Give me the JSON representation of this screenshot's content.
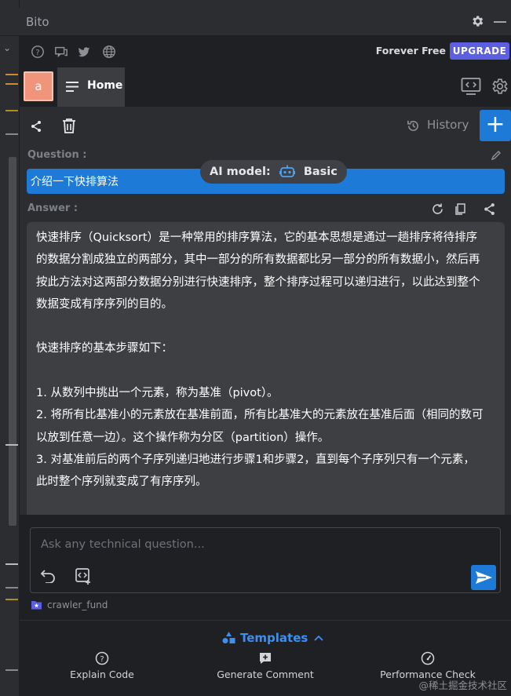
{
  "window": {
    "title": "Bito"
  },
  "topbar": {
    "icons": [
      "help-icon",
      "chat-icon",
      "twitter-icon",
      "globe-icon"
    ],
    "plan": "Forever Free",
    "upgrade_label": "UPGRADE"
  },
  "tabs": {
    "avatar_initial": "a",
    "home_label": "Home"
  },
  "toolbar": {
    "history_label": "History",
    "new_chat_symbol": "+"
  },
  "chat": {
    "question_label": "Question :",
    "question_text": "介绍一下快排算法",
    "model_label": "AI model:",
    "model_value": "Basic",
    "answer_label": "Answer :",
    "answer_lines": [
      "快速排序（Quicksort）是一种常用的排序算法，它的基本思想是通过一趟排序将待排序",
      "的数据分割成独立的两部分，其中一部分的所有数据都比另一部分的所有数据小，然后再",
      "按此方法对这两部分数据分别进行快速排序，整个排序过程可以递归进行，以此达到整个",
      "数据变成有序序列的目的。",
      "",
      "快速排序的基本步骤如下：",
      "",
      "1. 从数列中挑出一个元素，称为基准（pivot）。",
      "2. 将所有比基准小的元素放在基准前面，所有比基准大的元素放在基准后面（相同的数可",
      "以放到任意一边）。这个操作称为分区（partition）操作。",
      "3. 对基准前后的两个子序列递归地进行步骤1和步骤2，直到每个子序列只有一个元素，",
      "此时整个序列就变成了有序序列。"
    ]
  },
  "input": {
    "placeholder": "Ask any technical question...",
    "project_name": "crawler_fund"
  },
  "templates": {
    "label": "Templates",
    "actions": [
      "Explain Code",
      "Generate Comment",
      "Performance Check"
    ]
  },
  "watermark": "@稀土掘金技术社区",
  "colors": {
    "accent_blue": "#1d7ad6",
    "upgrade_purple": "#5b5fe0",
    "avatar": "#f0957b",
    "panel_bg": "#1f2023",
    "content_bg": "#2b2d31"
  }
}
